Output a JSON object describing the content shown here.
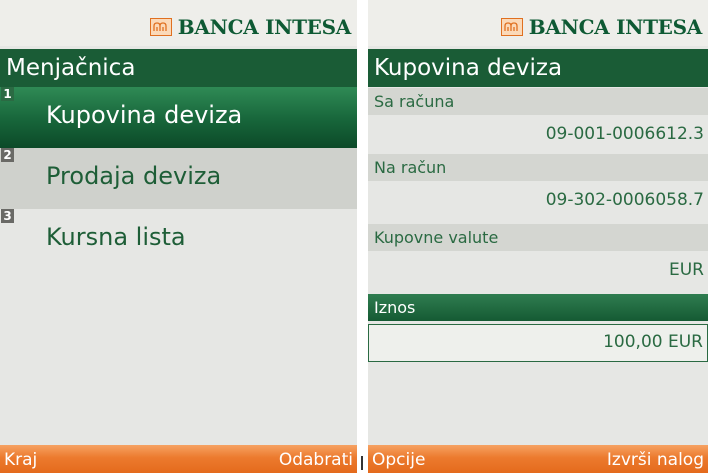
{
  "brand": {
    "name": "BANCA INTESA",
    "accent": "#1a5c36",
    "softkey_color": "#ec7a2e"
  },
  "left_screen": {
    "title": "Menjačnica",
    "menu": [
      {
        "number": "1",
        "label": "Kupovina deviza",
        "selected": true
      },
      {
        "number": "2",
        "label": "Prodaja deviza",
        "selected": false
      },
      {
        "number": "3",
        "label": "Kursna lista",
        "selected": false
      }
    ],
    "softkeys": {
      "left": "Kraj",
      "right": "Odabrati"
    }
  },
  "right_screen": {
    "title": "Kupovina deviza",
    "fields": [
      {
        "label": "Sa računa",
        "value": "09-001-0006612.3"
      },
      {
        "label": "Na račun",
        "value": "09-302-0006058.7"
      },
      {
        "label": "Kupovne valute",
        "value": "EUR"
      },
      {
        "label": "Iznos",
        "value": "100,00 EUR",
        "focused": true
      }
    ],
    "softkeys": {
      "left": "Opcije",
      "right": "Izvrši nalog"
    }
  }
}
